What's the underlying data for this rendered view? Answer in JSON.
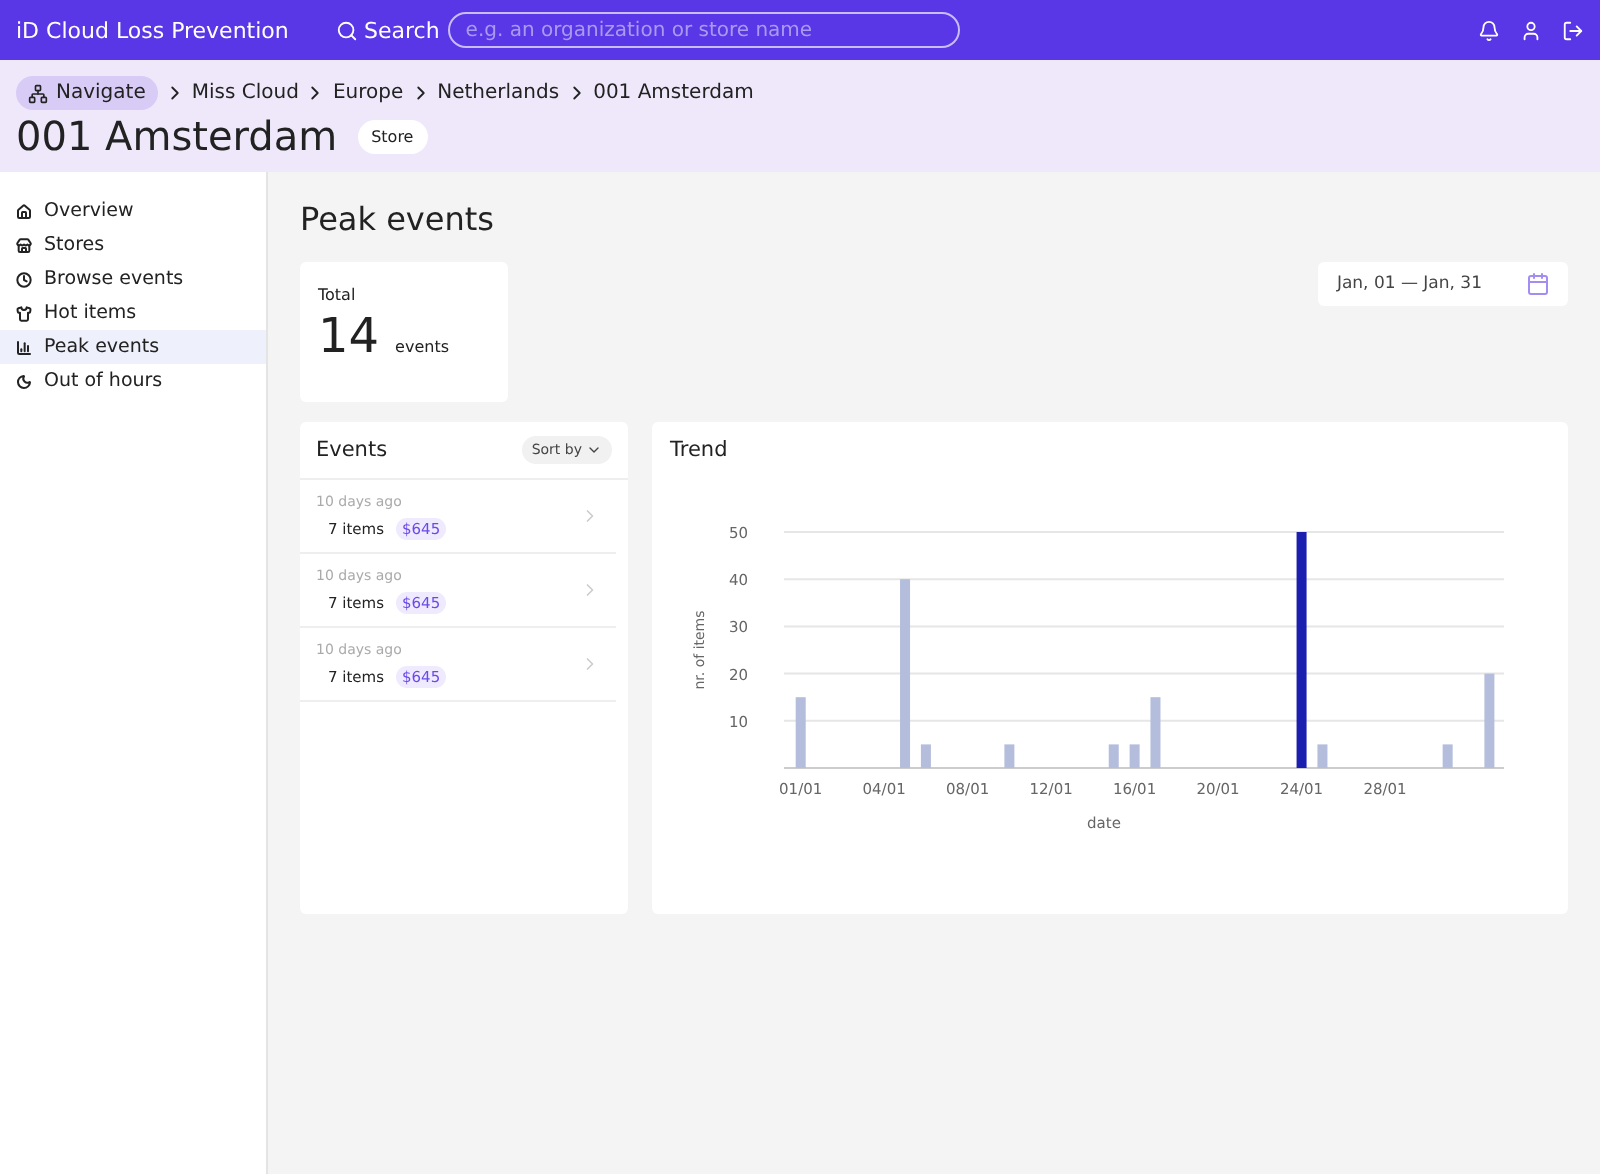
{
  "topbar": {
    "brand": "iD Cloud Loss Prevention",
    "search_label": "Search",
    "search": {
      "placeholder": "e.g. an organization or store name"
    }
  },
  "breadcrumb": {
    "navigate": "Navigate",
    "items": [
      "Miss Cloud",
      "Europe",
      "Netherlands",
      "001 Amsterdam"
    ]
  },
  "page": {
    "title": "001 Amsterdam",
    "badge": "Store"
  },
  "sidebar": {
    "items": [
      {
        "label": "Overview",
        "selected": false
      },
      {
        "label": "Stores",
        "selected": false
      },
      {
        "label": "Browse events",
        "selected": false
      },
      {
        "label": "Hot items",
        "selected": false
      },
      {
        "label": "Peak events",
        "selected": true
      },
      {
        "label": "Out of hours",
        "selected": false
      }
    ]
  },
  "content": {
    "title": "Peak events",
    "total": {
      "label": "Total",
      "value": "14",
      "unit": "events"
    },
    "date_range": "Jan, 01 — Jan, 31"
  },
  "events": {
    "title": "Events",
    "sort": "Sort by",
    "rows": [
      {
        "time": "10 days ago",
        "items": "7 items",
        "amount": "$645"
      },
      {
        "time": "10 days ago",
        "items": "7 items",
        "amount": "$645"
      },
      {
        "time": "10 days ago",
        "items": "7 items",
        "amount": "$645"
      }
    ]
  },
  "trend": {
    "title": "Trend",
    "chart_data": {
      "type": "bar",
      "xlabel": "date",
      "ylabel": "nr. of items",
      "categories": [
        "01/01",
        null,
        null,
        null,
        "04/01",
        null,
        null,
        null,
        "08/01",
        null,
        null,
        null,
        "12/01",
        null,
        null,
        null,
        "16/01",
        null,
        null,
        null,
        "20/01",
        null,
        null,
        null,
        "24/01",
        null,
        null,
        null,
        "28/01",
        null,
        null,
        null,
        null,
        null
      ],
      "series": [
        {
          "color": "#b4bddc",
          "values": [
            15,
            null,
            null,
            null,
            null,
            40,
            5,
            null,
            null,
            null,
            5,
            null,
            null,
            null,
            null,
            5,
            5,
            15,
            null,
            null,
            null,
            null,
            null,
            null,
            null,
            5,
            null,
            null,
            null,
            null,
            null,
            5,
            null,
            20
          ]
        },
        {
          "color": "#1a1fb0",
          "values": [
            null,
            null,
            null,
            null,
            null,
            null,
            null,
            null,
            null,
            null,
            null,
            null,
            null,
            null,
            null,
            null,
            null,
            null,
            null,
            null,
            null,
            null,
            null,
            null,
            50,
            null,
            null,
            null,
            null,
            null,
            null,
            null,
            null,
            null
          ]
        }
      ],
      "ylim": [
        0,
        50
      ],
      "yticks": [
        10,
        20,
        30,
        40,
        50
      ],
      "grid": true
    }
  }
}
